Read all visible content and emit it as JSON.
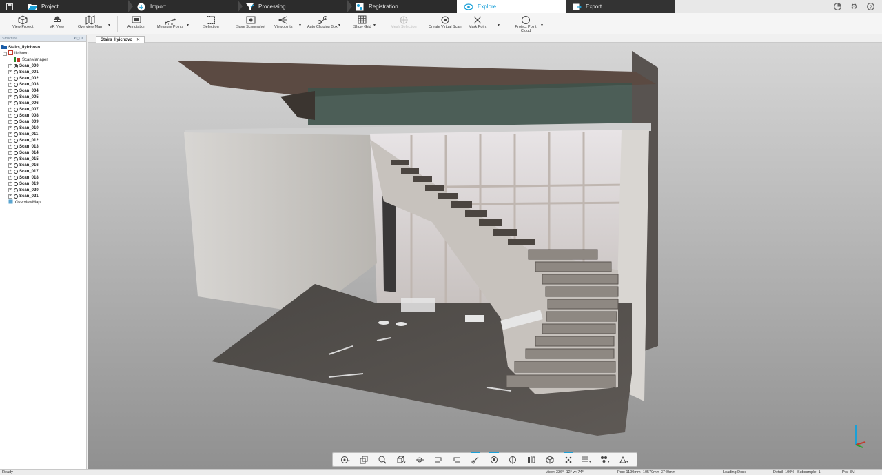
{
  "workflow_tabs": [
    {
      "label": "Project",
      "icon": "folder-icon"
    },
    {
      "label": "Import",
      "icon": "import-icon"
    },
    {
      "label": "Processing",
      "icon": "processing-icon"
    },
    {
      "label": "Registration",
      "icon": "registration-icon"
    },
    {
      "label": "Explore",
      "icon": "explore-icon",
      "active": true
    },
    {
      "label": "Export",
      "icon": "export-icon"
    }
  ],
  "ribbon": {
    "view_project": "View Project",
    "vr_view": "VR View",
    "overview_map": "Overview Map",
    "annotation": "Annotation",
    "measure_points": "Measure Points",
    "selection": "Selection",
    "save_screenshot": "Save Screenshot",
    "viewpoints": "Viewpoints",
    "auto_clipping_box": "Auto Clipping Box",
    "show_grid": "Show Grid",
    "mesh_selection": "Mesh Selection",
    "create_virtual_scan": "Create Virtual Scan",
    "mark_point": "Mark Point",
    "project_point_cloud": "Project Point Cloud"
  },
  "left_panel": {
    "title": "Structure",
    "tree": {
      "project": "Stairs_Ilyichovo",
      "cluster": "Ilichovo",
      "scan_manager": "ScanManager",
      "scans": [
        "Scan_000",
        "Scan_001",
        "Scan_002",
        "Scan_003",
        "Scan_004",
        "Scan_005",
        "Scan_006",
        "Scan_007",
        "Scan_008",
        "Scan_009",
        "Scan_010",
        "Scan_011",
        "Scan_012",
        "Scan_013",
        "Scan_014",
        "Scan_015",
        "Scan_016",
        "Scan_017",
        "Scan_018",
        "Scan_019",
        "Scan_020",
        "Scan_021"
      ],
      "overview_map": "OverviewMap"
    }
  },
  "document_tab": "Stairs_Ilyichovo",
  "status": {
    "ready": "Ready",
    "view": "View: 336° -12° w: 74°",
    "pos": "Pos: 1190mm -10570mm 3740mm",
    "loading": "Loading Done",
    "detail": "Detail: 100%",
    "subsample": "Subsample: 1",
    "pts": "Pts: 3M"
  },
  "colors": {
    "accent": "#1aa0d8",
    "topbar": "#2c2c2c"
  }
}
